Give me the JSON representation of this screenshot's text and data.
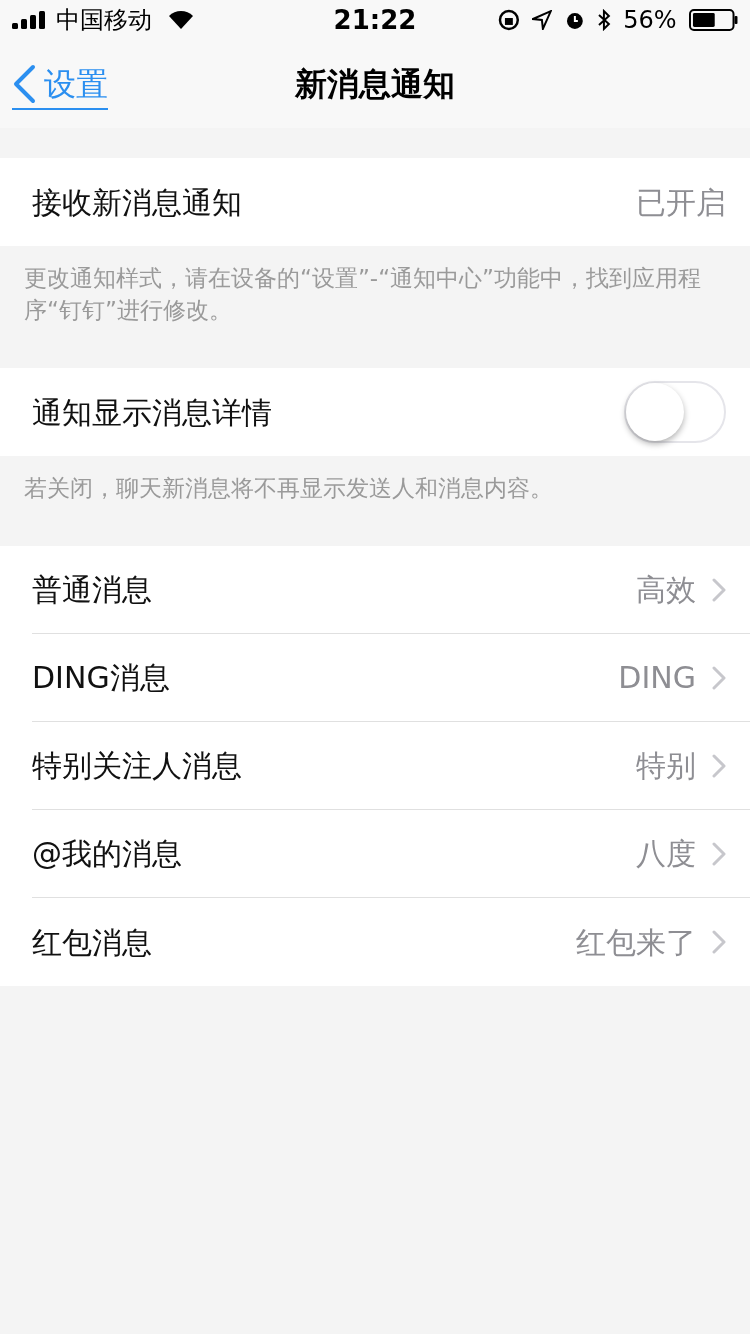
{
  "status_bar": {
    "carrier": "中国移动",
    "time": "21:22",
    "battery": "56%"
  },
  "nav": {
    "back": "设置",
    "title": "新消息通知"
  },
  "groups": [
    {
      "rows": [
        {
          "kind": "value",
          "label": "接收新消息通知",
          "value": "已开启"
        }
      ],
      "note": "更改通知样式，请在设备的“设置”-“通知中心”功能中，找到应用程序“钉钉”进行修改。"
    },
    {
      "rows": [
        {
          "kind": "toggle",
          "label": "通知显示消息详情",
          "on": false
        }
      ],
      "note": "若关闭，聊天新消息将不再显示发送人和消息内容。"
    },
    {
      "rows": [
        {
          "kind": "link",
          "label": "普通消息",
          "value": "高效"
        },
        {
          "kind": "link",
          "label": "DING消息",
          "value": "DING"
        },
        {
          "kind": "link",
          "label": "特别关注人消息",
          "value": "特别"
        },
        {
          "kind": "link",
          "label": "@我的消息",
          "value": "八度"
        },
        {
          "kind": "link",
          "label": "红包消息",
          "value": "红包来了"
        }
      ]
    }
  ]
}
